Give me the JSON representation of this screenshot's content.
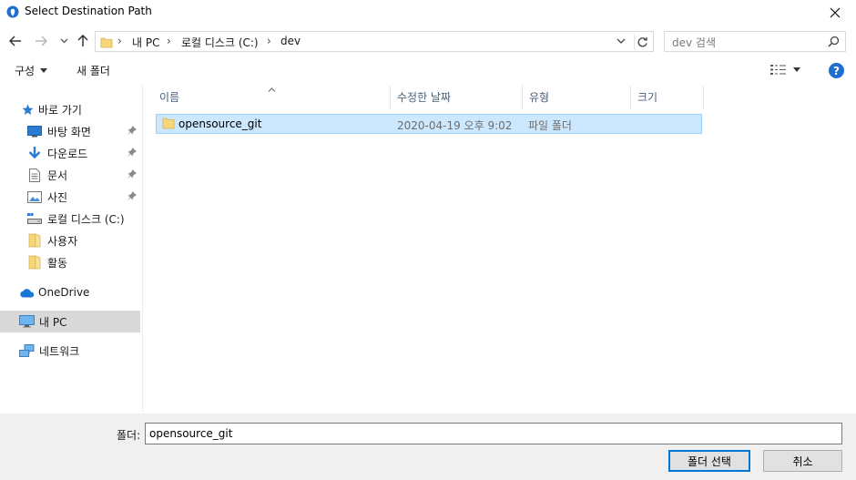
{
  "window": {
    "title": "Select Destination Path",
    "icon": "location-pin-icon",
    "close": "close-icon"
  },
  "navigation": {
    "back": "arrow-left-icon",
    "forward": "arrow-right-icon",
    "recent": "chevron-down-icon",
    "up": "arrow-up-icon"
  },
  "address": {
    "breadcrumbs": [
      "내 PC",
      "로컬 디스크 (C:)",
      "dev"
    ],
    "separator": "›"
  },
  "search": {
    "placeholder": "dev 검색"
  },
  "toolbar": {
    "organize_label": "구성",
    "new_folder_label": "새 폴더",
    "help_label": "?"
  },
  "sidebar": {
    "quick_access": "바로 가기",
    "items": [
      {
        "label": "바탕 화면",
        "icon": "desktop-icon",
        "pinned": true
      },
      {
        "label": "다운로드",
        "icon": "download-icon",
        "pinned": true
      },
      {
        "label": "문서",
        "icon": "document-icon",
        "pinned": true
      },
      {
        "label": "사진",
        "icon": "pictures-icon",
        "pinned": true
      },
      {
        "label": "로컬 디스크 (C:)",
        "icon": "drive-icon",
        "pinned": false
      },
      {
        "label": "사용자",
        "icon": "folder-icon",
        "pinned": false
      },
      {
        "label": "활동",
        "icon": "folder-icon",
        "pinned": false
      }
    ],
    "onedrive": "OneDrive",
    "this_pc": "내 PC",
    "network": "네트워크"
  },
  "filelist": {
    "columns": [
      "이름",
      "수정한 날짜",
      "유형",
      "크기"
    ],
    "rows": [
      {
        "name": "opensource_git",
        "modified": "2020-04-19 오후 9:02",
        "type": "파일 폴더",
        "size": ""
      }
    ]
  },
  "footer": {
    "folder_label": "폴더:",
    "folder_value": "opensource_git",
    "select_button": "폴더 선택",
    "cancel_button": "취소"
  },
  "colors": {
    "accent": "#0078d7",
    "selection": "#cce8ff",
    "folder": "#f5d67b",
    "help": "#1e6fd0"
  }
}
